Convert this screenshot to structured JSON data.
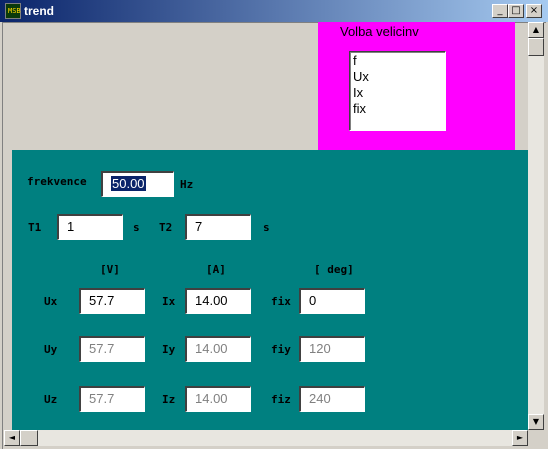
{
  "window": {
    "title": "trend",
    "icon_text": "MSB",
    "min_glyph": "_",
    "max_glyph": "□",
    "close_glyph": "×"
  },
  "quantity_panel": {
    "label": "Volba velicinv",
    "items": [
      "f",
      "Ux",
      "Ix",
      "fix"
    ],
    "color": "#ff00ff"
  },
  "frequency": {
    "label": "frekvence",
    "value": "50.00",
    "unit": "Hz"
  },
  "times": {
    "t1_label": "T1",
    "t1_value": "1",
    "t1_unit": "s",
    "t2_label": "T2",
    "t2_value": "7",
    "t2_unit": "s"
  },
  "headers": {
    "voltage": "[V]",
    "current": "[A]",
    "angle": "[ deg]"
  },
  "rows": [
    {
      "u_label": "Ux",
      "u_value": "57.7",
      "i_label": "Ix",
      "i_value": "14.00",
      "fi_label": "fix",
      "fi_value": "0"
    },
    {
      "u_label": "Uy",
      "u_value": "57.7",
      "i_label": "Iy",
      "i_value": "14.00",
      "fi_label": "fiy",
      "fi_value": "120"
    },
    {
      "u_label": "Uz",
      "u_value": "57.7",
      "i_label": "Iz",
      "i_value": "14.00",
      "fi_label": "fiz",
      "fi_value": "240"
    }
  ],
  "colors": {
    "panel_bg": "#008080",
    "title_bar": "#0a246a"
  },
  "scroll": {
    "up": "▲",
    "down": "▼",
    "left": "◄",
    "right": "►"
  }
}
